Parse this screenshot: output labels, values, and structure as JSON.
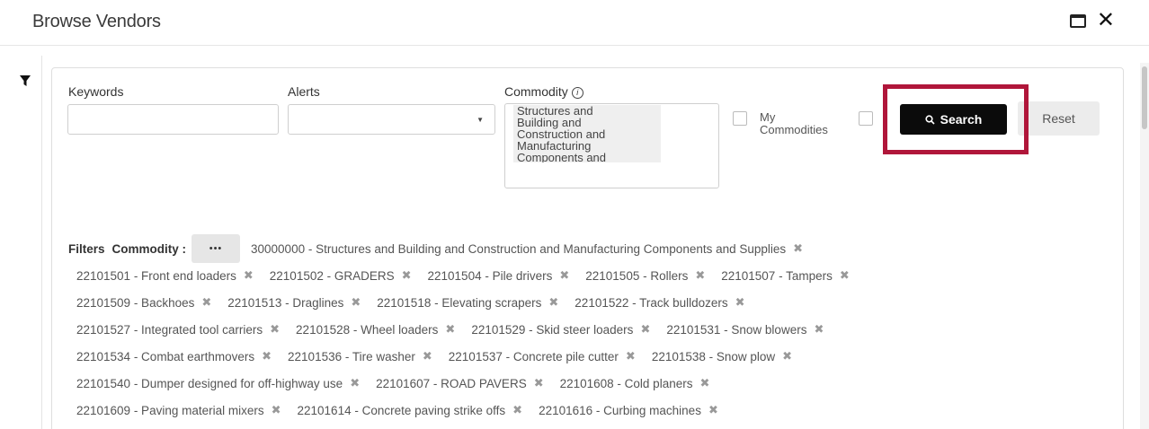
{
  "dialog": {
    "title": "Browse Vendors"
  },
  "form": {
    "keywords_label": "Keywords",
    "keywords_value": "",
    "alerts_label": "Alerts",
    "alerts_value": "",
    "commodity_label": "Commodity",
    "commodity_option": "Structures and\nBuilding and\nConstruction and\nManufacturing\nComponents and",
    "my_commodities_label": "My\nCommodities",
    "search_label": "Search",
    "reset_label": "Reset"
  },
  "filters": {
    "label": "Filters",
    "commodity_label": "Commodity :",
    "more_label": "•••",
    "chips": [
      "30000000 - Structures and Building and Construction and Manufacturing Components and Supplies",
      "22101501 - Front end loaders",
      "22101502 - GRADERS",
      "22101504 - Pile drivers",
      "22101505 - Rollers",
      "22101507 - Tampers",
      "22101509 - Backhoes",
      "22101513 - Draglines",
      "22101518 - Elevating scrapers",
      "22101522 - Track bulldozers",
      "22101527 - Integrated tool carriers",
      "22101528 - Wheel loaders",
      "22101529 - Skid steer loaders",
      "22101531 - Snow blowers",
      "22101534 - Combat earthmovers",
      "22101536 - Tire washer",
      "22101537 - Concrete pile cutter",
      "22101538 - Snow plow",
      "22101540 - Dumper designed for off-highway use",
      "22101607 - ROAD PAVERS",
      "22101608 - Cold planers",
      "22101609 - Paving material mixers",
      "22101614 - Concrete paving strike offs",
      "22101616 - Curbing machines"
    ]
  },
  "colors": {
    "highlight": "#b0163a",
    "search_button": "#0b0b0b"
  },
  "icons": [
    "filter-icon",
    "maximize-icon",
    "close-icon",
    "info-icon",
    "search-icon",
    "chip-remove-icon",
    "dropdown-caret-icon"
  ]
}
